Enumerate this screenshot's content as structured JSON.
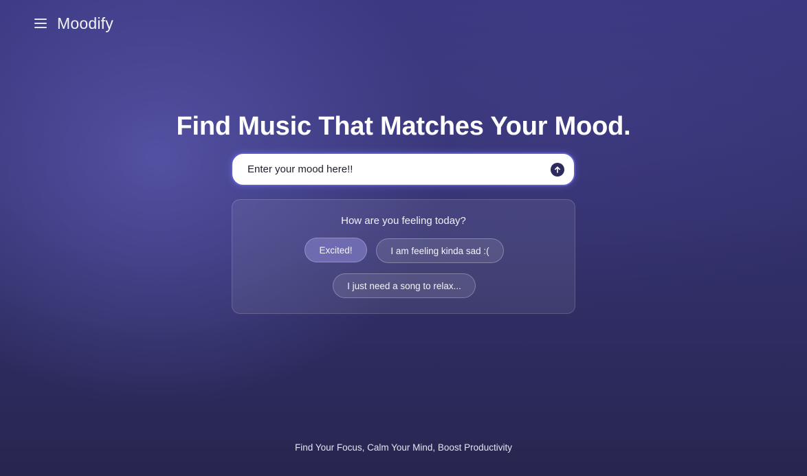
{
  "header": {
    "brand": "Moodify",
    "menu_icon": "hamburger-menu-icon"
  },
  "hero": {
    "headline": "Find Music That Matches Your Mood."
  },
  "search": {
    "value": "Enter your mood here!!",
    "send_icon": "arrow-up-circle-icon"
  },
  "suggestions": {
    "title": "How are you feeling today?",
    "chips": [
      {
        "label": "Excited!",
        "active": true
      },
      {
        "label": "I am feeling kinda sad :(",
        "active": false
      },
      {
        "label": "I just need a song to relax...",
        "active": false
      }
    ]
  },
  "footer": {
    "tagline": "Find Your Focus, Calm Your Mind, Boost Productivity"
  },
  "colors": {
    "background": "#343270",
    "accent": "#5e5cc9",
    "chip_active": "#6e6bb0",
    "send_button": "#2d2b5e"
  }
}
